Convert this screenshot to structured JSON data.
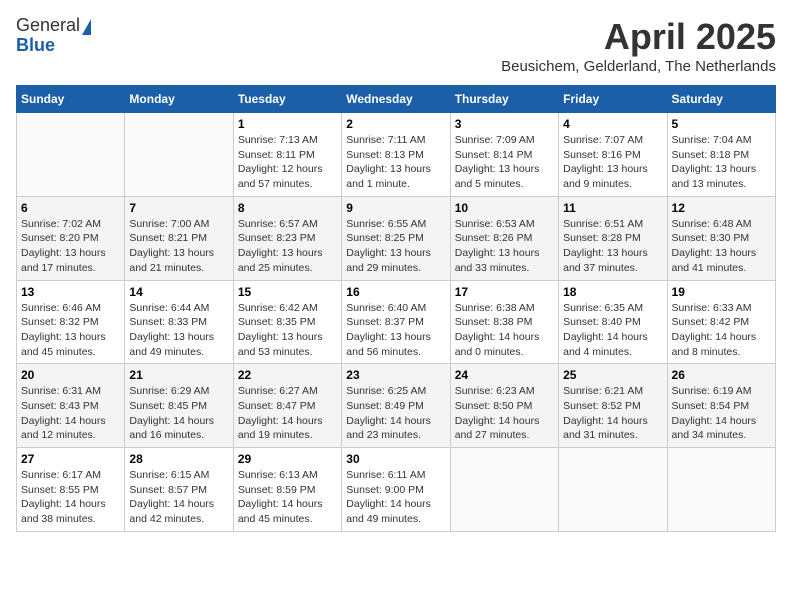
{
  "header": {
    "logo_general": "General",
    "logo_blue": "Blue",
    "month": "April 2025",
    "location": "Beusichem, Gelderland, The Netherlands"
  },
  "days_of_week": [
    "Sunday",
    "Monday",
    "Tuesday",
    "Wednesday",
    "Thursday",
    "Friday",
    "Saturday"
  ],
  "weeks": [
    [
      {
        "day": "",
        "detail": ""
      },
      {
        "day": "",
        "detail": ""
      },
      {
        "day": "1",
        "detail": "Sunrise: 7:13 AM\nSunset: 8:11 PM\nDaylight: 12 hours and 57 minutes."
      },
      {
        "day": "2",
        "detail": "Sunrise: 7:11 AM\nSunset: 8:13 PM\nDaylight: 13 hours and 1 minute."
      },
      {
        "day": "3",
        "detail": "Sunrise: 7:09 AM\nSunset: 8:14 PM\nDaylight: 13 hours and 5 minutes."
      },
      {
        "day": "4",
        "detail": "Sunrise: 7:07 AM\nSunset: 8:16 PM\nDaylight: 13 hours and 9 minutes."
      },
      {
        "day": "5",
        "detail": "Sunrise: 7:04 AM\nSunset: 8:18 PM\nDaylight: 13 hours and 13 minutes."
      }
    ],
    [
      {
        "day": "6",
        "detail": "Sunrise: 7:02 AM\nSunset: 8:20 PM\nDaylight: 13 hours and 17 minutes."
      },
      {
        "day": "7",
        "detail": "Sunrise: 7:00 AM\nSunset: 8:21 PM\nDaylight: 13 hours and 21 minutes."
      },
      {
        "day": "8",
        "detail": "Sunrise: 6:57 AM\nSunset: 8:23 PM\nDaylight: 13 hours and 25 minutes."
      },
      {
        "day": "9",
        "detail": "Sunrise: 6:55 AM\nSunset: 8:25 PM\nDaylight: 13 hours and 29 minutes."
      },
      {
        "day": "10",
        "detail": "Sunrise: 6:53 AM\nSunset: 8:26 PM\nDaylight: 13 hours and 33 minutes."
      },
      {
        "day": "11",
        "detail": "Sunrise: 6:51 AM\nSunset: 8:28 PM\nDaylight: 13 hours and 37 minutes."
      },
      {
        "day": "12",
        "detail": "Sunrise: 6:48 AM\nSunset: 8:30 PM\nDaylight: 13 hours and 41 minutes."
      }
    ],
    [
      {
        "day": "13",
        "detail": "Sunrise: 6:46 AM\nSunset: 8:32 PM\nDaylight: 13 hours and 45 minutes."
      },
      {
        "day": "14",
        "detail": "Sunrise: 6:44 AM\nSunset: 8:33 PM\nDaylight: 13 hours and 49 minutes."
      },
      {
        "day": "15",
        "detail": "Sunrise: 6:42 AM\nSunset: 8:35 PM\nDaylight: 13 hours and 53 minutes."
      },
      {
        "day": "16",
        "detail": "Sunrise: 6:40 AM\nSunset: 8:37 PM\nDaylight: 13 hours and 56 minutes."
      },
      {
        "day": "17",
        "detail": "Sunrise: 6:38 AM\nSunset: 8:38 PM\nDaylight: 14 hours and 0 minutes."
      },
      {
        "day": "18",
        "detail": "Sunrise: 6:35 AM\nSunset: 8:40 PM\nDaylight: 14 hours and 4 minutes."
      },
      {
        "day": "19",
        "detail": "Sunrise: 6:33 AM\nSunset: 8:42 PM\nDaylight: 14 hours and 8 minutes."
      }
    ],
    [
      {
        "day": "20",
        "detail": "Sunrise: 6:31 AM\nSunset: 8:43 PM\nDaylight: 14 hours and 12 minutes."
      },
      {
        "day": "21",
        "detail": "Sunrise: 6:29 AM\nSunset: 8:45 PM\nDaylight: 14 hours and 16 minutes."
      },
      {
        "day": "22",
        "detail": "Sunrise: 6:27 AM\nSunset: 8:47 PM\nDaylight: 14 hours and 19 minutes."
      },
      {
        "day": "23",
        "detail": "Sunrise: 6:25 AM\nSunset: 8:49 PM\nDaylight: 14 hours and 23 minutes."
      },
      {
        "day": "24",
        "detail": "Sunrise: 6:23 AM\nSunset: 8:50 PM\nDaylight: 14 hours and 27 minutes."
      },
      {
        "day": "25",
        "detail": "Sunrise: 6:21 AM\nSunset: 8:52 PM\nDaylight: 14 hours and 31 minutes."
      },
      {
        "day": "26",
        "detail": "Sunrise: 6:19 AM\nSunset: 8:54 PM\nDaylight: 14 hours and 34 minutes."
      }
    ],
    [
      {
        "day": "27",
        "detail": "Sunrise: 6:17 AM\nSunset: 8:55 PM\nDaylight: 14 hours and 38 minutes."
      },
      {
        "day": "28",
        "detail": "Sunrise: 6:15 AM\nSunset: 8:57 PM\nDaylight: 14 hours and 42 minutes."
      },
      {
        "day": "29",
        "detail": "Sunrise: 6:13 AM\nSunset: 8:59 PM\nDaylight: 14 hours and 45 minutes."
      },
      {
        "day": "30",
        "detail": "Sunrise: 6:11 AM\nSunset: 9:00 PM\nDaylight: 14 hours and 49 minutes."
      },
      {
        "day": "",
        "detail": ""
      },
      {
        "day": "",
        "detail": ""
      },
      {
        "day": "",
        "detail": ""
      }
    ]
  ]
}
